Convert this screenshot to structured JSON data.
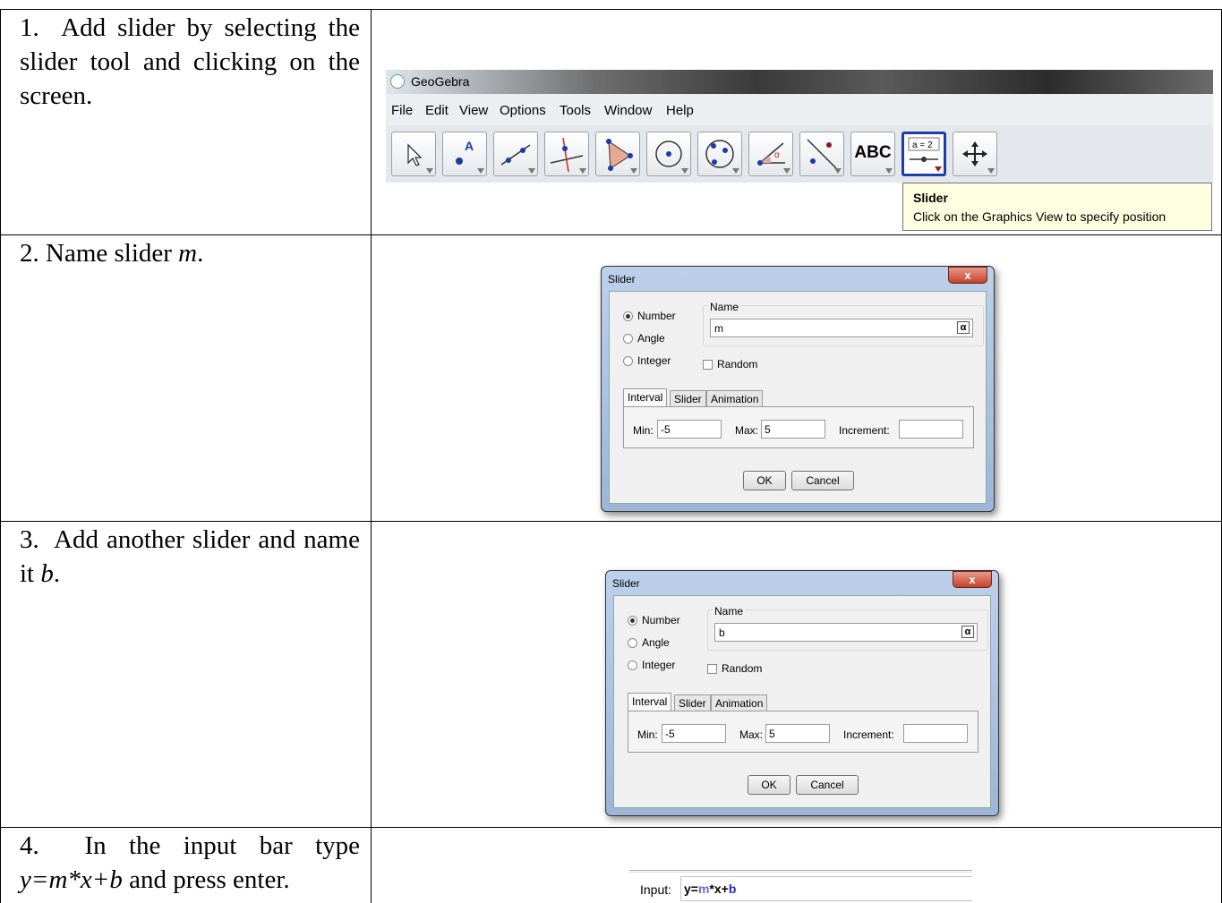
{
  "steps": [
    {
      "num": "1.",
      "text": "Add slider by selecting the slider tool and clicking on the screen."
    },
    {
      "num": "2.",
      "text_pre": "Name slider ",
      "var": "m",
      "text_post": "."
    },
    {
      "num": "3.",
      "text_pre": "Add another slider and name it ",
      "var": "b",
      "text_post": "."
    },
    {
      "num": "4.",
      "text_pre": "In the input bar type ",
      "formula": "y=m*x+b",
      "text_post": " and press enter."
    }
  ],
  "geogebra": {
    "title": "GeoGebra",
    "menu": [
      "File",
      "Edit",
      "View",
      "Options",
      "Tools",
      "Window",
      "Help"
    ],
    "tools": [
      "move-tool",
      "point-tool",
      "line-tool",
      "perpendicular-tool",
      "polygon-tool",
      "circle-tool",
      "conic-tool",
      "angle-tool",
      "reflect-tool",
      "text-tool",
      "slider-tool",
      "move-graphics-tool"
    ],
    "text_tool_label": "ABC",
    "slider_tool_label": "a = 2",
    "tooltip_title": "Slider",
    "tooltip_text": "Click on the Graphics View to specify position"
  },
  "dialog1": {
    "title": "Slider",
    "close": "x",
    "radio": [
      "Number",
      "Angle",
      "Integer"
    ],
    "name_label": "Name",
    "name_value": "m",
    "alpha": "α",
    "random_label": "Random",
    "tabs": [
      "Interval",
      "Slider",
      "Animation"
    ],
    "min_label": "Min:",
    "min_value": "-5",
    "max_label": "Max:",
    "max_value": "5",
    "inc_label": "Increment:",
    "inc_value": "",
    "ok": "OK",
    "cancel": "Cancel"
  },
  "dialog2": {
    "title": "Slider",
    "close": "x",
    "radio": [
      "Number",
      "Angle",
      "Integer"
    ],
    "name_label": "Name",
    "name_value": "b",
    "alpha": "α",
    "random_label": "Random",
    "tabs": [
      "Interval",
      "Slider",
      "Animation"
    ],
    "min_label": "Min:",
    "min_value": "-5",
    "max_label": "Max:",
    "max_value": "5",
    "inc_label": "Increment:",
    "inc_value": "",
    "ok": "OK",
    "cancel": "Cancel"
  },
  "inputbar": {
    "label": "Input:",
    "parts": [
      "y=",
      "m",
      "*x+",
      "b"
    ]
  }
}
